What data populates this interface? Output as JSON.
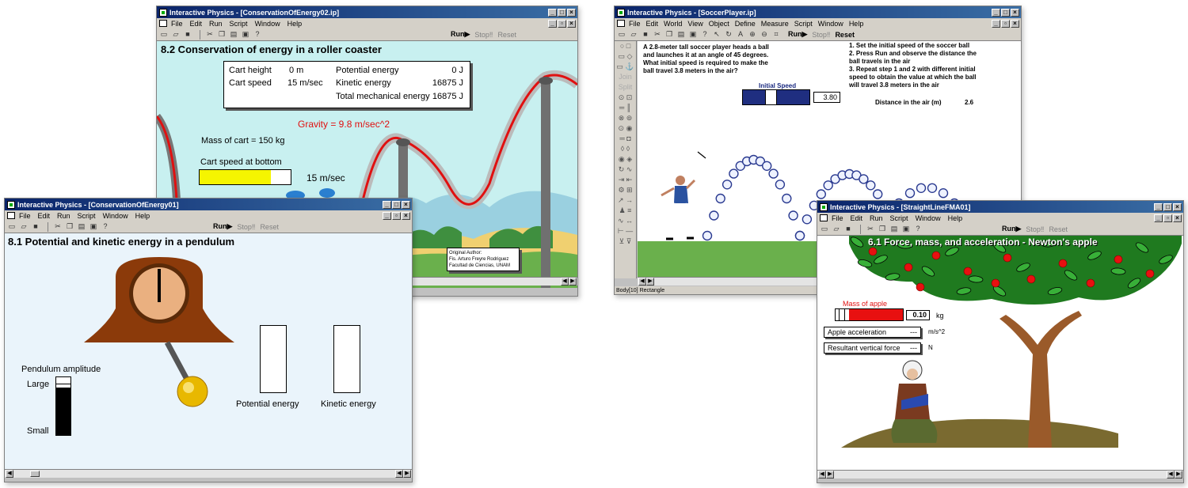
{
  "coaster_window": {
    "title": "Interactive Physics - [ConservationOfEnergy02.ip]",
    "menu": [
      "File",
      "Edit",
      "Run",
      "Script",
      "Window",
      "Help"
    ],
    "run": "Run▶",
    "stop": "Stop‼",
    "reset": "Reset",
    "heading": "8.2 Conservation of energy in a roller coaster",
    "panel": {
      "cart_height_label": "Cart height",
      "cart_height_value": "0 m",
      "cart_speed_label": "Cart speed",
      "cart_speed_value": "15 m/sec",
      "potential_label": "Potential energy",
      "potential_value": "0 J",
      "kinetic_label": "Kinetic energy",
      "kinetic_value": "16875 J",
      "total_label": "Total mechanical energy",
      "total_value": "16875 J"
    },
    "gravity": "Gravity = 9.8 m/sec^2",
    "mass": "Mass of cart = 150 kg",
    "speed_label": "Cart speed at bottom",
    "speed_value": "15  m/sec",
    "speed_fraction": 0.78,
    "author_line1": "Original Author:",
    "author_line2": "Fis. Arturo Freyre Rodriguez",
    "author_line3": "Facultad de Ciencias, UNAM"
  },
  "pendulum_window": {
    "title": "Interactive Physics - [ConservationOfEnergy01]",
    "menu": [
      "File",
      "Edit",
      "Run",
      "Script",
      "Window",
      "Help"
    ],
    "run": "Run▶",
    "stop": "Stop‼",
    "reset": "Reset",
    "heading": "8.1 Potential and kinetic energy in a pendulum",
    "amplitude_label": "Pendulum amplitude",
    "large": "Large",
    "small": "Small",
    "amplitude_fraction": 0.85,
    "potential_label": "Potential energy",
    "kinetic_label": "Kinetic energy"
  },
  "soccer_window": {
    "title": "Interactive Physics - [SoccerPlayer.ip]",
    "menu": [
      "File",
      "Edit",
      "World",
      "View",
      "Object",
      "Define",
      "Measure",
      "Script",
      "Window",
      "Help"
    ],
    "run": "Run▶",
    "stop": "Stop‼",
    "reset": "Reset",
    "problem": "A 2.8-meter tall soccer player heads a ball and launches it at an angle of 45 degrees. What initial speed is required to make the ball travel 3.8 meters in the air?",
    "steps": "1. Set the initial speed of the soccer ball\n2. Press Run and observe the distance the ball travels in the air\n3. Repeat step 1 and 2 with different initial speed to obtain the value at which the ball will travel 3.8 meters in the air",
    "initial_speed_label": "Initial Speed",
    "initial_speed_value": "3.80",
    "distance_label": "Distance in the air (m)",
    "distance_value": "2.6",
    "status": "Body[10] Rectangle"
  },
  "apple_window": {
    "title": "Interactive Physics - [StraightLineFMA01]",
    "menu": [
      "File",
      "Edit",
      "Run",
      "Script",
      "Window",
      "Help"
    ],
    "run": "Run▶",
    "stop": "Stop‼",
    "reset": "Reset",
    "heading": "6.1 Force, mass, and acceleration - Newton's apple",
    "mass_label": "Mass of apple",
    "mass_value": "0.10",
    "mass_unit": "kg",
    "mass_fraction": 0.8,
    "accel_label": "Apple acceleration",
    "accel_value": "---",
    "accel_unit": "m/s^2",
    "force_label": "Resultant vertical force",
    "force_value": "---",
    "force_unit": "N"
  },
  "colors": {
    "title_bar": "#0a246a",
    "coaster_sky": "#c8f0f0",
    "track_red": "#e01010",
    "grass": "#6ab04c",
    "speed_fill": "#f5f500",
    "pendulum_bg": "#eaf4fb",
    "clock_wood": "#8b3a0a",
    "apple_red": "#e81010"
  }
}
